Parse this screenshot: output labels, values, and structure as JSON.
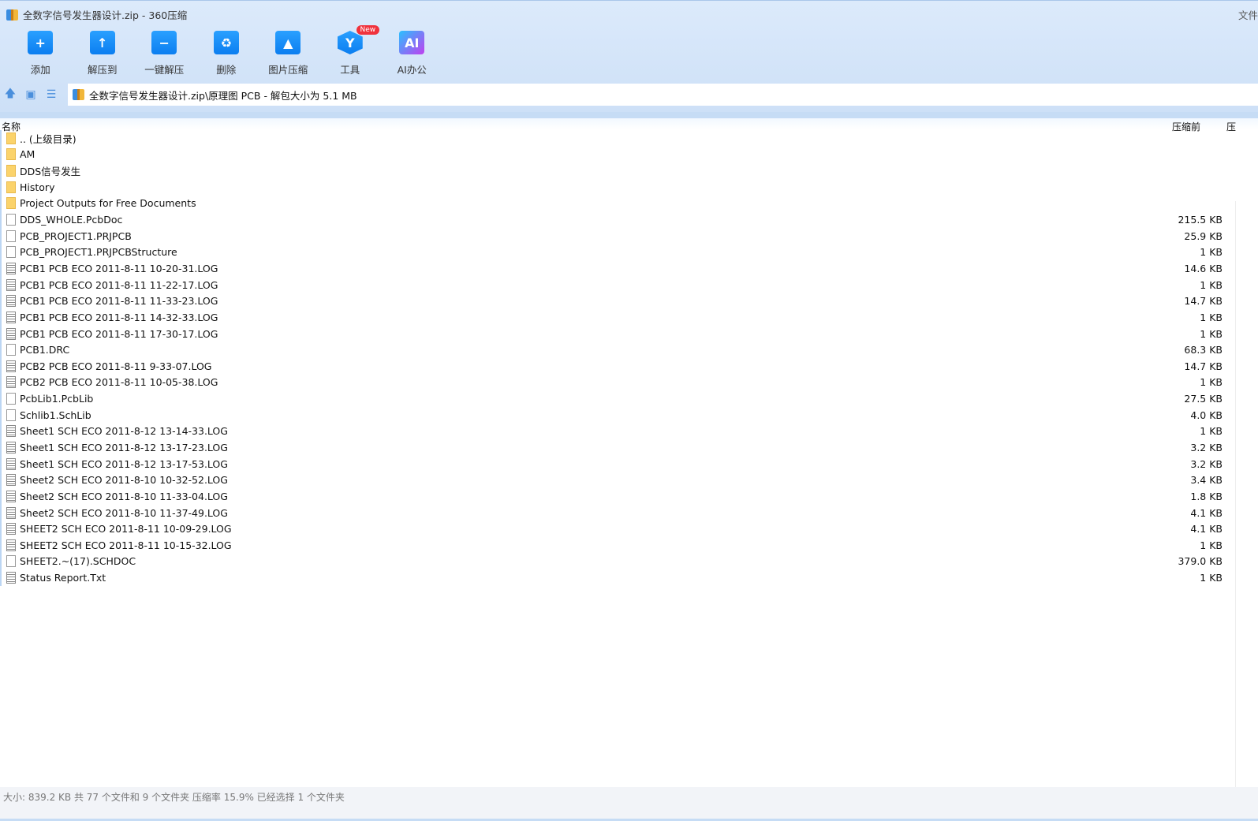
{
  "window": {
    "title": "全数字信号发生器设计.zip - 360压缩",
    "right_label": "文件"
  },
  "toolbar": [
    {
      "label": "添加",
      "icon": "+"
    },
    {
      "label": "解压到",
      "icon": "↑"
    },
    {
      "label": "一键解压",
      "icon": "−"
    },
    {
      "label": "删除",
      "icon": "♻"
    },
    {
      "label": "图片压缩",
      "icon": "▲"
    },
    {
      "label": "工具",
      "icon": "Y",
      "badge": "New"
    },
    {
      "label": "AI办公",
      "icon": "AI"
    }
  ],
  "address": {
    "path": "全数字信号发生器设计.zip\\原理图 PCB - 解包大小为 5.1 MB"
  },
  "columns": {
    "name": "名称",
    "size": "压缩前",
    "packed": "压"
  },
  "files": [
    {
      "name": ".. (上级目录)",
      "type": "folder",
      "size": ""
    },
    {
      "name": "AM",
      "type": "folder",
      "size": ""
    },
    {
      "name": "DDS信号发生",
      "type": "folder",
      "size": ""
    },
    {
      "name": "History",
      "type": "folder",
      "size": ""
    },
    {
      "name": "Project Outputs for Free Documents",
      "type": "folder",
      "size": ""
    },
    {
      "name": "DDS_WHOLE.PcbDoc",
      "type": "blank",
      "size": "215.5 KB"
    },
    {
      "name": "PCB_PROJECT1.PRJPCB",
      "type": "blank",
      "size": "25.9 KB"
    },
    {
      "name": "PCB_PROJECT1.PRJPCBStructure",
      "type": "blank",
      "size": "1 KB"
    },
    {
      "name": "PCB1 PCB ECO 2011-8-11 10-20-31.LOG",
      "type": "text",
      "size": "14.6 KB"
    },
    {
      "name": "PCB1 PCB ECO 2011-8-11 11-22-17.LOG",
      "type": "text",
      "size": "1 KB"
    },
    {
      "name": "PCB1 PCB ECO 2011-8-11 11-33-23.LOG",
      "type": "text",
      "size": "14.7 KB"
    },
    {
      "name": "PCB1 PCB ECO 2011-8-11 14-32-33.LOG",
      "type": "text",
      "size": "1 KB"
    },
    {
      "name": "PCB1 PCB ECO 2011-8-11 17-30-17.LOG",
      "type": "text",
      "size": "1 KB"
    },
    {
      "name": "PCB1.DRC",
      "type": "blank",
      "size": "68.3 KB"
    },
    {
      "name": "PCB2 PCB ECO 2011-8-11 9-33-07.LOG",
      "type": "text",
      "size": "14.7 KB"
    },
    {
      "name": "PCB2 PCB ECO 2011-8-11 10-05-38.LOG",
      "type": "text",
      "size": "1 KB"
    },
    {
      "name": "PcbLib1.PcbLib",
      "type": "blank",
      "size": "27.5 KB"
    },
    {
      "name": "Schlib1.SchLib",
      "type": "blank",
      "size": "4.0 KB"
    },
    {
      "name": "Sheet1 SCH ECO 2011-8-12 13-14-33.LOG",
      "type": "text",
      "size": "1 KB"
    },
    {
      "name": "Sheet1 SCH ECO 2011-8-12 13-17-23.LOG",
      "type": "text",
      "size": "3.2 KB"
    },
    {
      "name": "Sheet1 SCH ECO 2011-8-12 13-17-53.LOG",
      "type": "text",
      "size": "3.2 KB"
    },
    {
      "name": "Sheet2 SCH ECO 2011-8-10 10-32-52.LOG",
      "type": "text",
      "size": "3.4 KB"
    },
    {
      "name": "Sheet2 SCH ECO 2011-8-10 11-33-04.LOG",
      "type": "text",
      "size": "1.8 KB"
    },
    {
      "name": "Sheet2 SCH ECO 2011-8-10 11-37-49.LOG",
      "type": "text",
      "size": "4.1 KB"
    },
    {
      "name": "SHEET2 SCH ECO 2011-8-11 10-09-29.LOG",
      "type": "text",
      "size": "4.1 KB"
    },
    {
      "name": "SHEET2 SCH ECO 2011-8-11 10-15-32.LOG",
      "type": "text",
      "size": "1 KB"
    },
    {
      "name": "SHEET2.~(17).SCHDOC",
      "type": "blank",
      "size": "379.0 KB"
    },
    {
      "name": "Status Report.Txt",
      "type": "text",
      "size": "1 KB"
    }
  ],
  "status": "大小: 839.2 KB 共 77 个文件和 9 个文件夹 压缩率 15.9% 已经选择 1 个文件夹"
}
